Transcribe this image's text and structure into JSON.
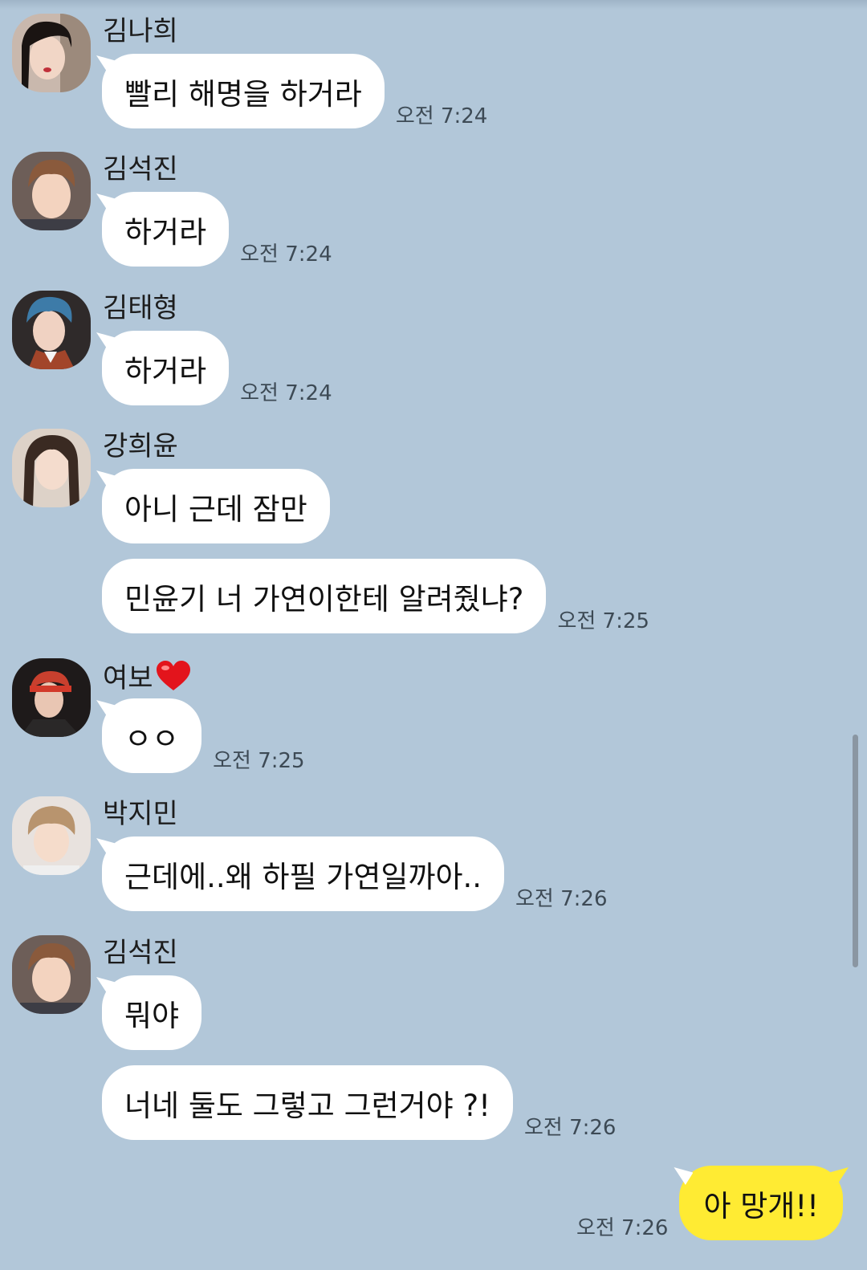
{
  "chat": {
    "messages_groups": [
      {
        "sender": "김나희",
        "avatar_icon": "profile-photo-icon",
        "messages": [
          {
            "text": "빨리 해명을 하거라",
            "time": "오전 7:24"
          }
        ]
      },
      {
        "sender": "김석진",
        "avatar_icon": "profile-photo-icon",
        "messages": [
          {
            "text": "하거라",
            "time": "오전 7:24"
          }
        ]
      },
      {
        "sender": "김태형",
        "avatar_icon": "profile-photo-icon",
        "messages": [
          {
            "text": "하거라",
            "time": "오전 7:24"
          }
        ]
      },
      {
        "sender": "강희윤",
        "avatar_icon": "profile-photo-icon",
        "messages": [
          {
            "text": "아니 근데 잠만",
            "time": ""
          },
          {
            "text": "민윤기 너 가연이한테 알려줬냐?",
            "time": "오전 7:25"
          }
        ]
      },
      {
        "sender": "여보",
        "sender_emoji": "❤️",
        "avatar_icon": "profile-photo-icon",
        "messages": [
          {
            "text": "ㅇㅇ",
            "time": "오전 7:25"
          }
        ]
      },
      {
        "sender": "박지민",
        "avatar_icon": "profile-photo-icon",
        "messages": [
          {
            "text": "근데에..왜 하필 가연일까아..",
            "time": "오전 7:26"
          }
        ]
      },
      {
        "sender": "김석진",
        "avatar_icon": "profile-photo-icon",
        "messages": [
          {
            "text": "뭐야",
            "time": ""
          },
          {
            "text": "너네 둘도 그렇고 그런거야 ?!",
            "time": "오전 7:26"
          }
        ]
      }
    ],
    "my_message": {
      "text": "아 망개!!",
      "time": "오전 7:26"
    }
  },
  "colors": {
    "background": "#b2c7d9",
    "incoming_bubble": "#ffffff",
    "outgoing_bubble": "#ffeb33"
  }
}
